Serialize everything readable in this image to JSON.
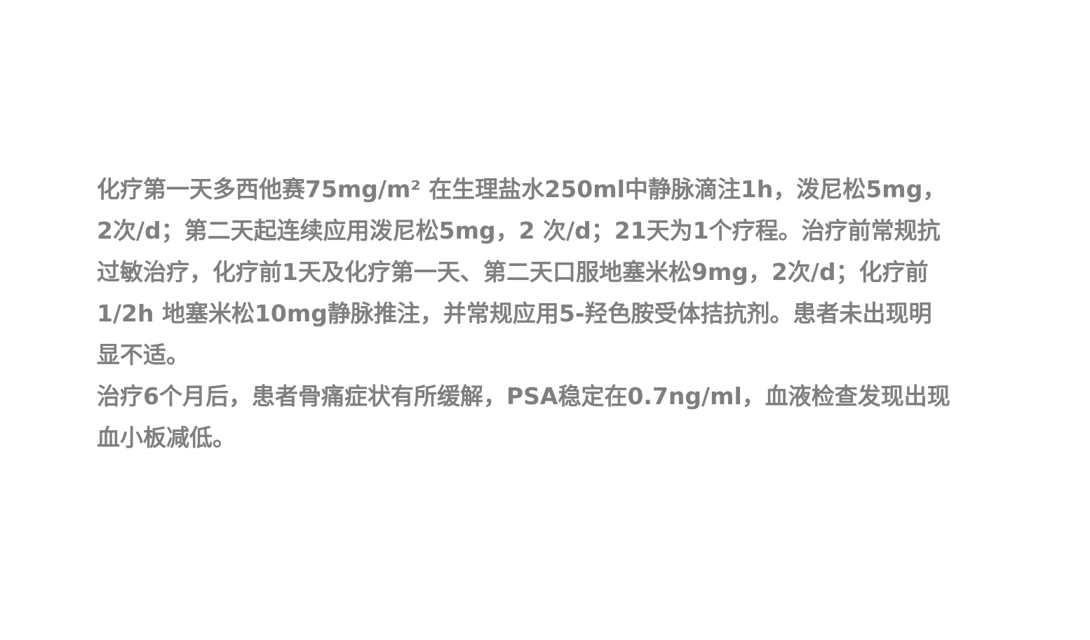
{
  "document": {
    "paragraphs": [
      "化疗第一天多西他赛75mg/m² 在生理盐水250ml中静脉滴注1h，泼尼松5mg，\n2次/d；第二天起连续应用泼尼松5mg，2 次/d；21天为1个疗程。治疗前常规抗\n过敏治疗，化疗前1天及化疗第一天、第二天口服地塞米松9mg，2次/d；化疗前\n1/2h 地塞米松10mg静脉推注，并常规应用5-羟色胺受体拮抗剂。患者未出现明\n显不适。",
      "治疗6个月后，患者骨痛症状有所缓解，PSA稳定在0.7ng/ml，血液检查发现出现\n血小板减低。"
    ],
    "text_color": "#7f7f7f",
    "background_color": "#ffffff"
  }
}
